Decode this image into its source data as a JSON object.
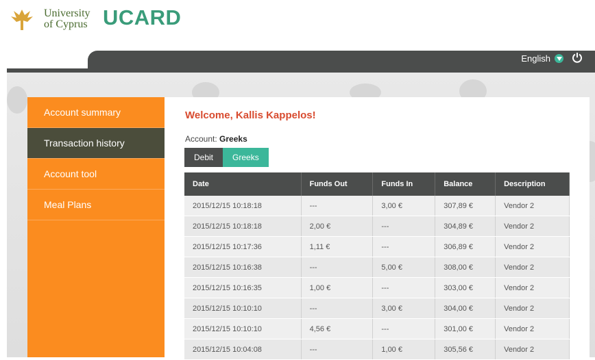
{
  "header": {
    "university_line1": "University",
    "university_line2": "of Cyprus",
    "app_name": "UCARD"
  },
  "topbar": {
    "language": "English"
  },
  "sidebar": {
    "items": [
      {
        "label": "Account summary"
      },
      {
        "label": "Transaction history"
      },
      {
        "label": "Account tool"
      },
      {
        "label": "Meal Plans"
      }
    ],
    "active_index": 1
  },
  "main": {
    "welcome": "Welcome, Kallis Kappelos!",
    "account_label": "Account:",
    "account_value": "Greeks",
    "tabs": [
      {
        "label": "Debit"
      },
      {
        "label": "Greeks"
      }
    ],
    "table": {
      "headers": [
        "Date",
        "Funds Out",
        "Funds In",
        "Balance",
        "Description"
      ],
      "rows": [
        [
          "2015/12/15 10:18:18",
          "---",
          "3,00 €",
          "307,89 €",
          "Vendor 2"
        ],
        [
          "2015/12/15 10:18:18",
          "2,00 €",
          "---",
          "304,89 €",
          "Vendor 2"
        ],
        [
          "2015/12/15 10:17:36",
          "1,11 €",
          "---",
          "306,89 €",
          "Vendor 2"
        ],
        [
          "2015/12/15 10:16:38",
          "---",
          "5,00 €",
          "308,00 €",
          "Vendor 2"
        ],
        [
          "2015/12/15 10:16:35",
          "1,00 €",
          "---",
          "303,00 €",
          "Vendor 2"
        ],
        [
          "2015/12/15 10:10:10",
          "---",
          "3,00 €",
          "304,00 €",
          "Vendor 2"
        ],
        [
          "2015/12/15 10:10:10",
          "4,56 €",
          "---",
          "301,00 €",
          "Vendor 2"
        ],
        [
          "2015/12/15 10:04:08",
          "---",
          "1,00 €",
          "305,56 €",
          "Vendor 2"
        ]
      ]
    }
  },
  "colors": {
    "brand_orange": "#fb8c1f",
    "brand_green": "#3cb79a",
    "dark_bar": "#4b4d4c",
    "welcome_red": "#d84b2f"
  }
}
